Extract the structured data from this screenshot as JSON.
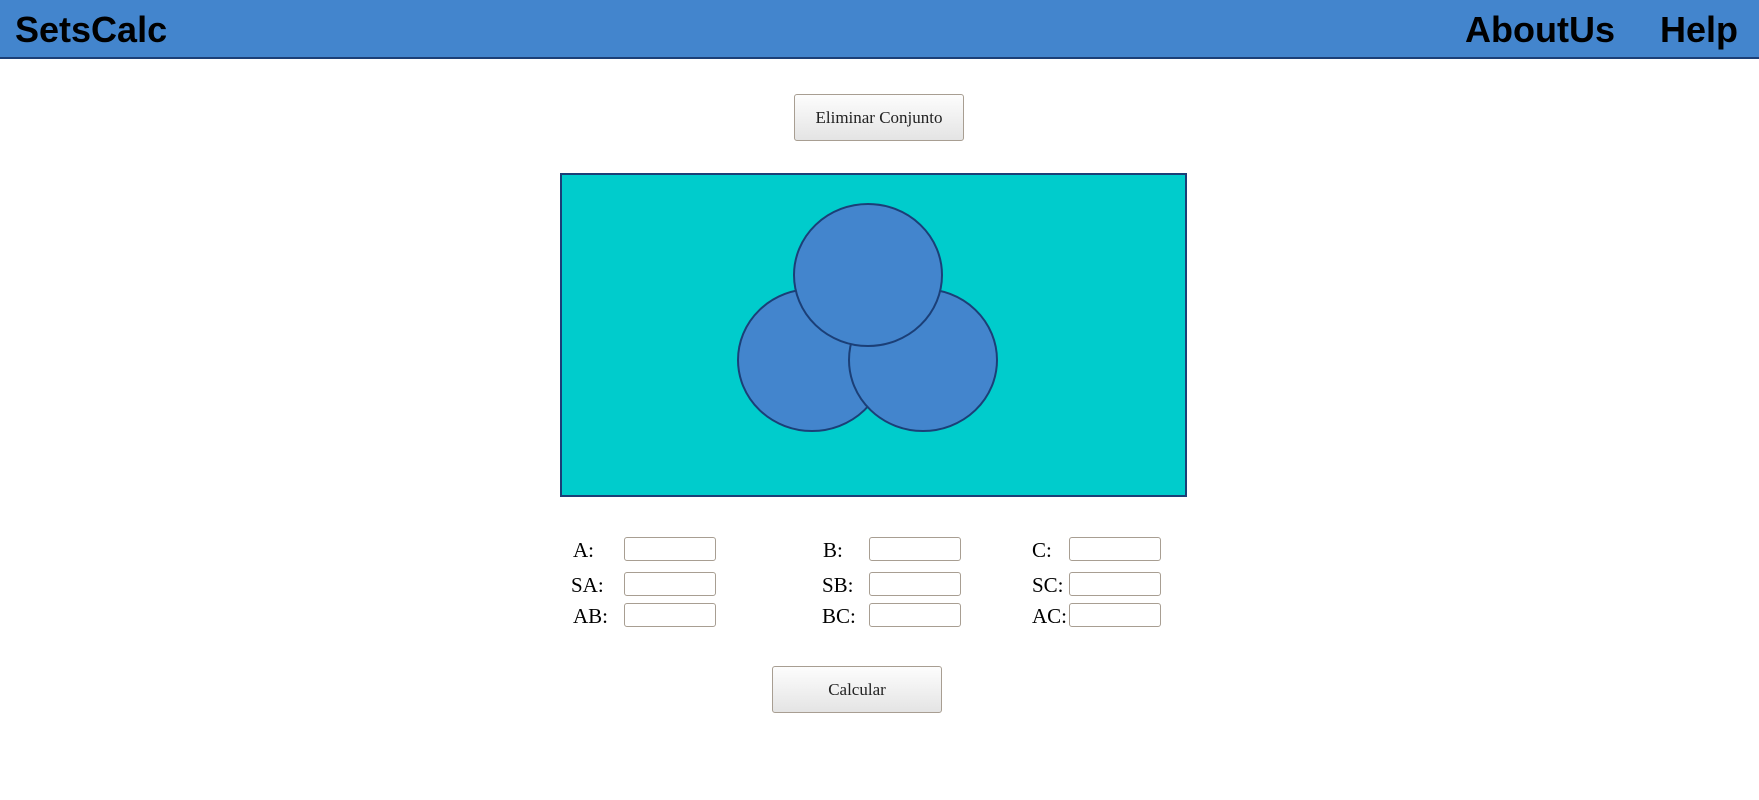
{
  "header": {
    "brand": "SetsCalc",
    "links": [
      "AboutUs",
      "Help"
    ]
  },
  "buttons": {
    "delete_set": "Eliminar Conjunto",
    "calculate": "Calcular"
  },
  "venn": {
    "background": "#00cccc",
    "circle_fill": "#4385cd",
    "circle_stroke": "#1b3f77"
  },
  "fields": {
    "A": {
      "label": "A:",
      "value": ""
    },
    "B": {
      "label": "B:",
      "value": ""
    },
    "C": {
      "label": "C:",
      "value": ""
    },
    "SA": {
      "label": "SA:",
      "value": ""
    },
    "SB": {
      "label": "SB:",
      "value": ""
    },
    "SC": {
      "label": "SC:",
      "value": ""
    },
    "AB": {
      "label": "AB:",
      "value": ""
    },
    "BC": {
      "label": "BC:",
      "value": ""
    },
    "AC": {
      "label": "AC:",
      "value": ""
    }
  },
  "colors": {
    "header_bg": "#4385cd",
    "header_border": "#1b3f77"
  }
}
